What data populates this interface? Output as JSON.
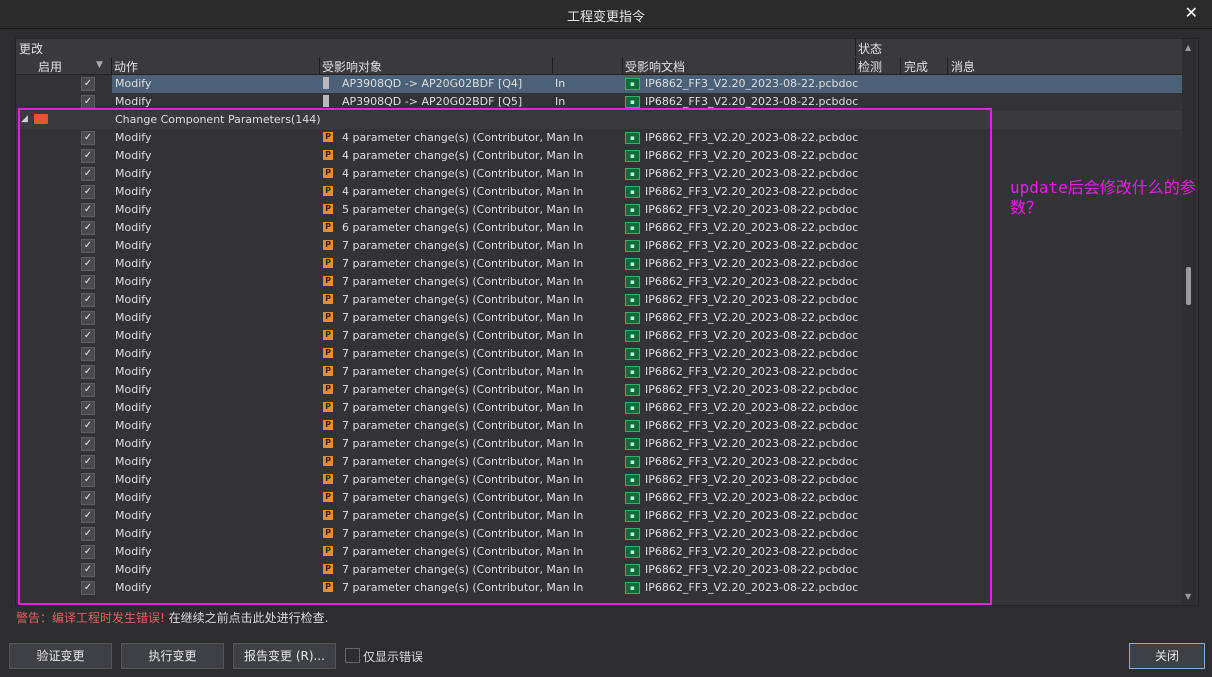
{
  "window": {
    "title": "工程变更指令",
    "close_glyph": "✕"
  },
  "columns": {
    "group_change": "更改",
    "group_status": "状态",
    "enable": "启用",
    "action": "动作",
    "affected_object": "受影响对象",
    "affected_doc": "受影响文档",
    "check": "检测",
    "done": "完成",
    "message": "消息"
  },
  "top_rows": [
    {
      "action": "Modify",
      "object": "AP3908QD -> AP20G02BDF [Q4]",
      "in": "In",
      "doc": "IP6862_FF3_V2.20_2023-08-22.pcbdoc",
      "selected": true
    },
    {
      "action": "Modify",
      "object": "AP3908QD -> AP20G02BDF [Q5]",
      "in": "In",
      "doc": "IP6862_FF3_V2.20_2023-08-22.pcbdoc",
      "selected": false
    }
  ],
  "group": {
    "label": "Change Component Parameters(144)"
  },
  "param_rows": [
    {
      "action": "Modify",
      "object": "4 parameter change(s) (Contributor, Man In",
      "doc": "IP6862_FF3_V2.20_2023-08-22.pcbdoc"
    },
    {
      "action": "Modify",
      "object": "4 parameter change(s) (Contributor, Man In",
      "doc": "IP6862_FF3_V2.20_2023-08-22.pcbdoc"
    },
    {
      "action": "Modify",
      "object": "4 parameter change(s) (Contributor, Man In",
      "doc": "IP6862_FF3_V2.20_2023-08-22.pcbdoc"
    },
    {
      "action": "Modify",
      "object": "4 parameter change(s) (Contributor, Man In",
      "doc": "IP6862_FF3_V2.20_2023-08-22.pcbdoc"
    },
    {
      "action": "Modify",
      "object": "5 parameter change(s) (Contributor, Man In",
      "doc": "IP6862_FF3_V2.20_2023-08-22.pcbdoc"
    },
    {
      "action": "Modify",
      "object": "6 parameter change(s) (Contributor, Man In",
      "doc": "IP6862_FF3_V2.20_2023-08-22.pcbdoc"
    },
    {
      "action": "Modify",
      "object": "7 parameter change(s) (Contributor, Man In",
      "doc": "IP6862_FF3_V2.20_2023-08-22.pcbdoc"
    },
    {
      "action": "Modify",
      "object": "7 parameter change(s) (Contributor, Man In",
      "doc": "IP6862_FF3_V2.20_2023-08-22.pcbdoc"
    },
    {
      "action": "Modify",
      "object": "7 parameter change(s) (Contributor, Man In",
      "doc": "IP6862_FF3_V2.20_2023-08-22.pcbdoc"
    },
    {
      "action": "Modify",
      "object": "7 parameter change(s) (Contributor, Man In",
      "doc": "IP6862_FF3_V2.20_2023-08-22.pcbdoc"
    },
    {
      "action": "Modify",
      "object": "7 parameter change(s) (Contributor, Man In",
      "doc": "IP6862_FF3_V2.20_2023-08-22.pcbdoc"
    },
    {
      "action": "Modify",
      "object": "7 parameter change(s) (Contributor, Man In",
      "doc": "IP6862_FF3_V2.20_2023-08-22.pcbdoc"
    },
    {
      "action": "Modify",
      "object": "7 parameter change(s) (Contributor, Man In",
      "doc": "IP6862_FF3_V2.20_2023-08-22.pcbdoc"
    },
    {
      "action": "Modify",
      "object": "7 parameter change(s) (Contributor, Man In",
      "doc": "IP6862_FF3_V2.20_2023-08-22.pcbdoc"
    },
    {
      "action": "Modify",
      "object": "7 parameter change(s) (Contributor, Man In",
      "doc": "IP6862_FF3_V2.20_2023-08-22.pcbdoc"
    },
    {
      "action": "Modify",
      "object": "7 parameter change(s) (Contributor, Man In",
      "doc": "IP6862_FF3_V2.20_2023-08-22.pcbdoc"
    },
    {
      "action": "Modify",
      "object": "7 parameter change(s) (Contributor, Man In",
      "doc": "IP6862_FF3_V2.20_2023-08-22.pcbdoc"
    },
    {
      "action": "Modify",
      "object": "7 parameter change(s) (Contributor, Man In",
      "doc": "IP6862_FF3_V2.20_2023-08-22.pcbdoc"
    },
    {
      "action": "Modify",
      "object": "7 parameter change(s) (Contributor, Man In",
      "doc": "IP6862_FF3_V2.20_2023-08-22.pcbdoc"
    },
    {
      "action": "Modify",
      "object": "7 parameter change(s) (Contributor, Man In",
      "doc": "IP6862_FF3_V2.20_2023-08-22.pcbdoc"
    },
    {
      "action": "Modify",
      "object": "7 parameter change(s) (Contributor, Man In",
      "doc": "IP6862_FF3_V2.20_2023-08-22.pcbdoc"
    },
    {
      "action": "Modify",
      "object": "7 parameter change(s) (Contributor, Man In",
      "doc": "IP6862_FF3_V2.20_2023-08-22.pcbdoc"
    },
    {
      "action": "Modify",
      "object": "7 parameter change(s) (Contributor, Man In",
      "doc": "IP6862_FF3_V2.20_2023-08-22.pcbdoc"
    },
    {
      "action": "Modify",
      "object": "7 parameter change(s) (Contributor, Man In",
      "doc": "IP6862_FF3_V2.20_2023-08-22.pcbdoc"
    },
    {
      "action": "Modify",
      "object": "7 parameter change(s) (Contributor, Man In",
      "doc": "IP6862_FF3_V2.20_2023-08-22.pcbdoc"
    },
    {
      "action": "Modify",
      "object": "7 parameter change(s) (Contributor, Man In",
      "doc": "IP6862_FF3_V2.20_2023-08-22.pcbdoc"
    }
  ],
  "icons": {
    "param": "P",
    "doc": "▪"
  },
  "annotation": {
    "text": "update后会修改什么的参数？",
    "color": "#e81ee8"
  },
  "warning": {
    "prefix": "警告：编译工程时发生错误!",
    "rest": " 在继续之前点击此处进行检查."
  },
  "footer": {
    "validate": "验证变更",
    "execute": "执行变更",
    "report": "报告变更 (R)...",
    "only_errors": "仅显示错误",
    "close": "关闭"
  }
}
